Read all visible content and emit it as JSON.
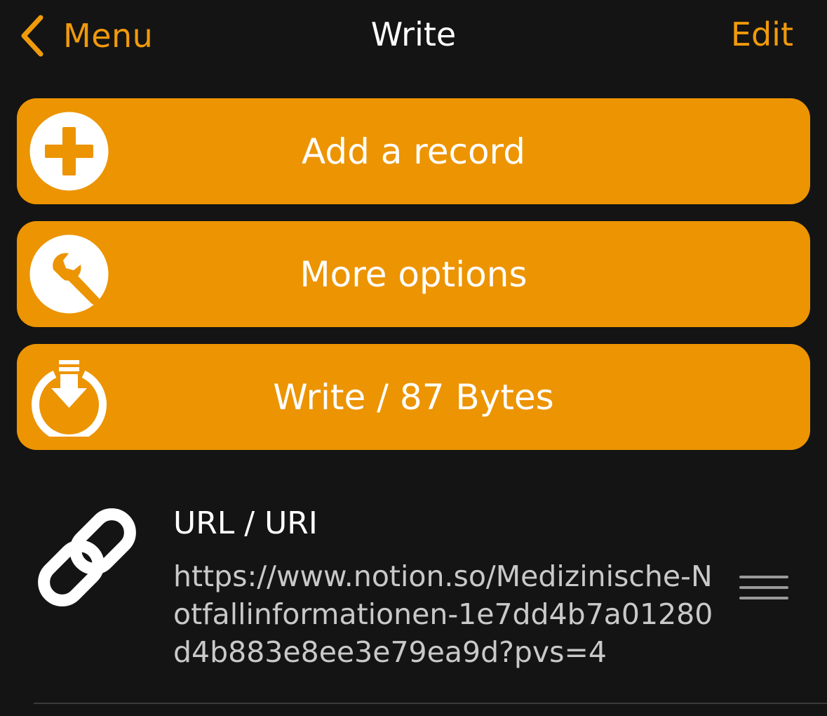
{
  "colors": {
    "background": "#141414",
    "accent": "#F09A0B",
    "button_fill": "#EC9401",
    "text_primary": "#ffffff",
    "text_secondary": "#c9c9c9"
  },
  "navbar": {
    "back_icon": "chevron-left-icon",
    "back_label": "Menu",
    "title": "Write",
    "edit_label": "Edit"
  },
  "actions": [
    {
      "icon": "plus-circle-icon",
      "label": "Add a record"
    },
    {
      "icon": "wrench-circle-icon",
      "label": "More options"
    },
    {
      "icon": "download-circle-icon",
      "label": "Write / 87 Bytes"
    }
  ],
  "records": [
    {
      "icon": "link-icon",
      "type": "URL / URI",
      "value": "https://www.notion.so/Medizinische-Notfallinformationen-1e7dd4b7a01280d4b883e8ee3e79ea9d?pvs=4",
      "handle_icon": "reorder-handle-icon"
    }
  ]
}
